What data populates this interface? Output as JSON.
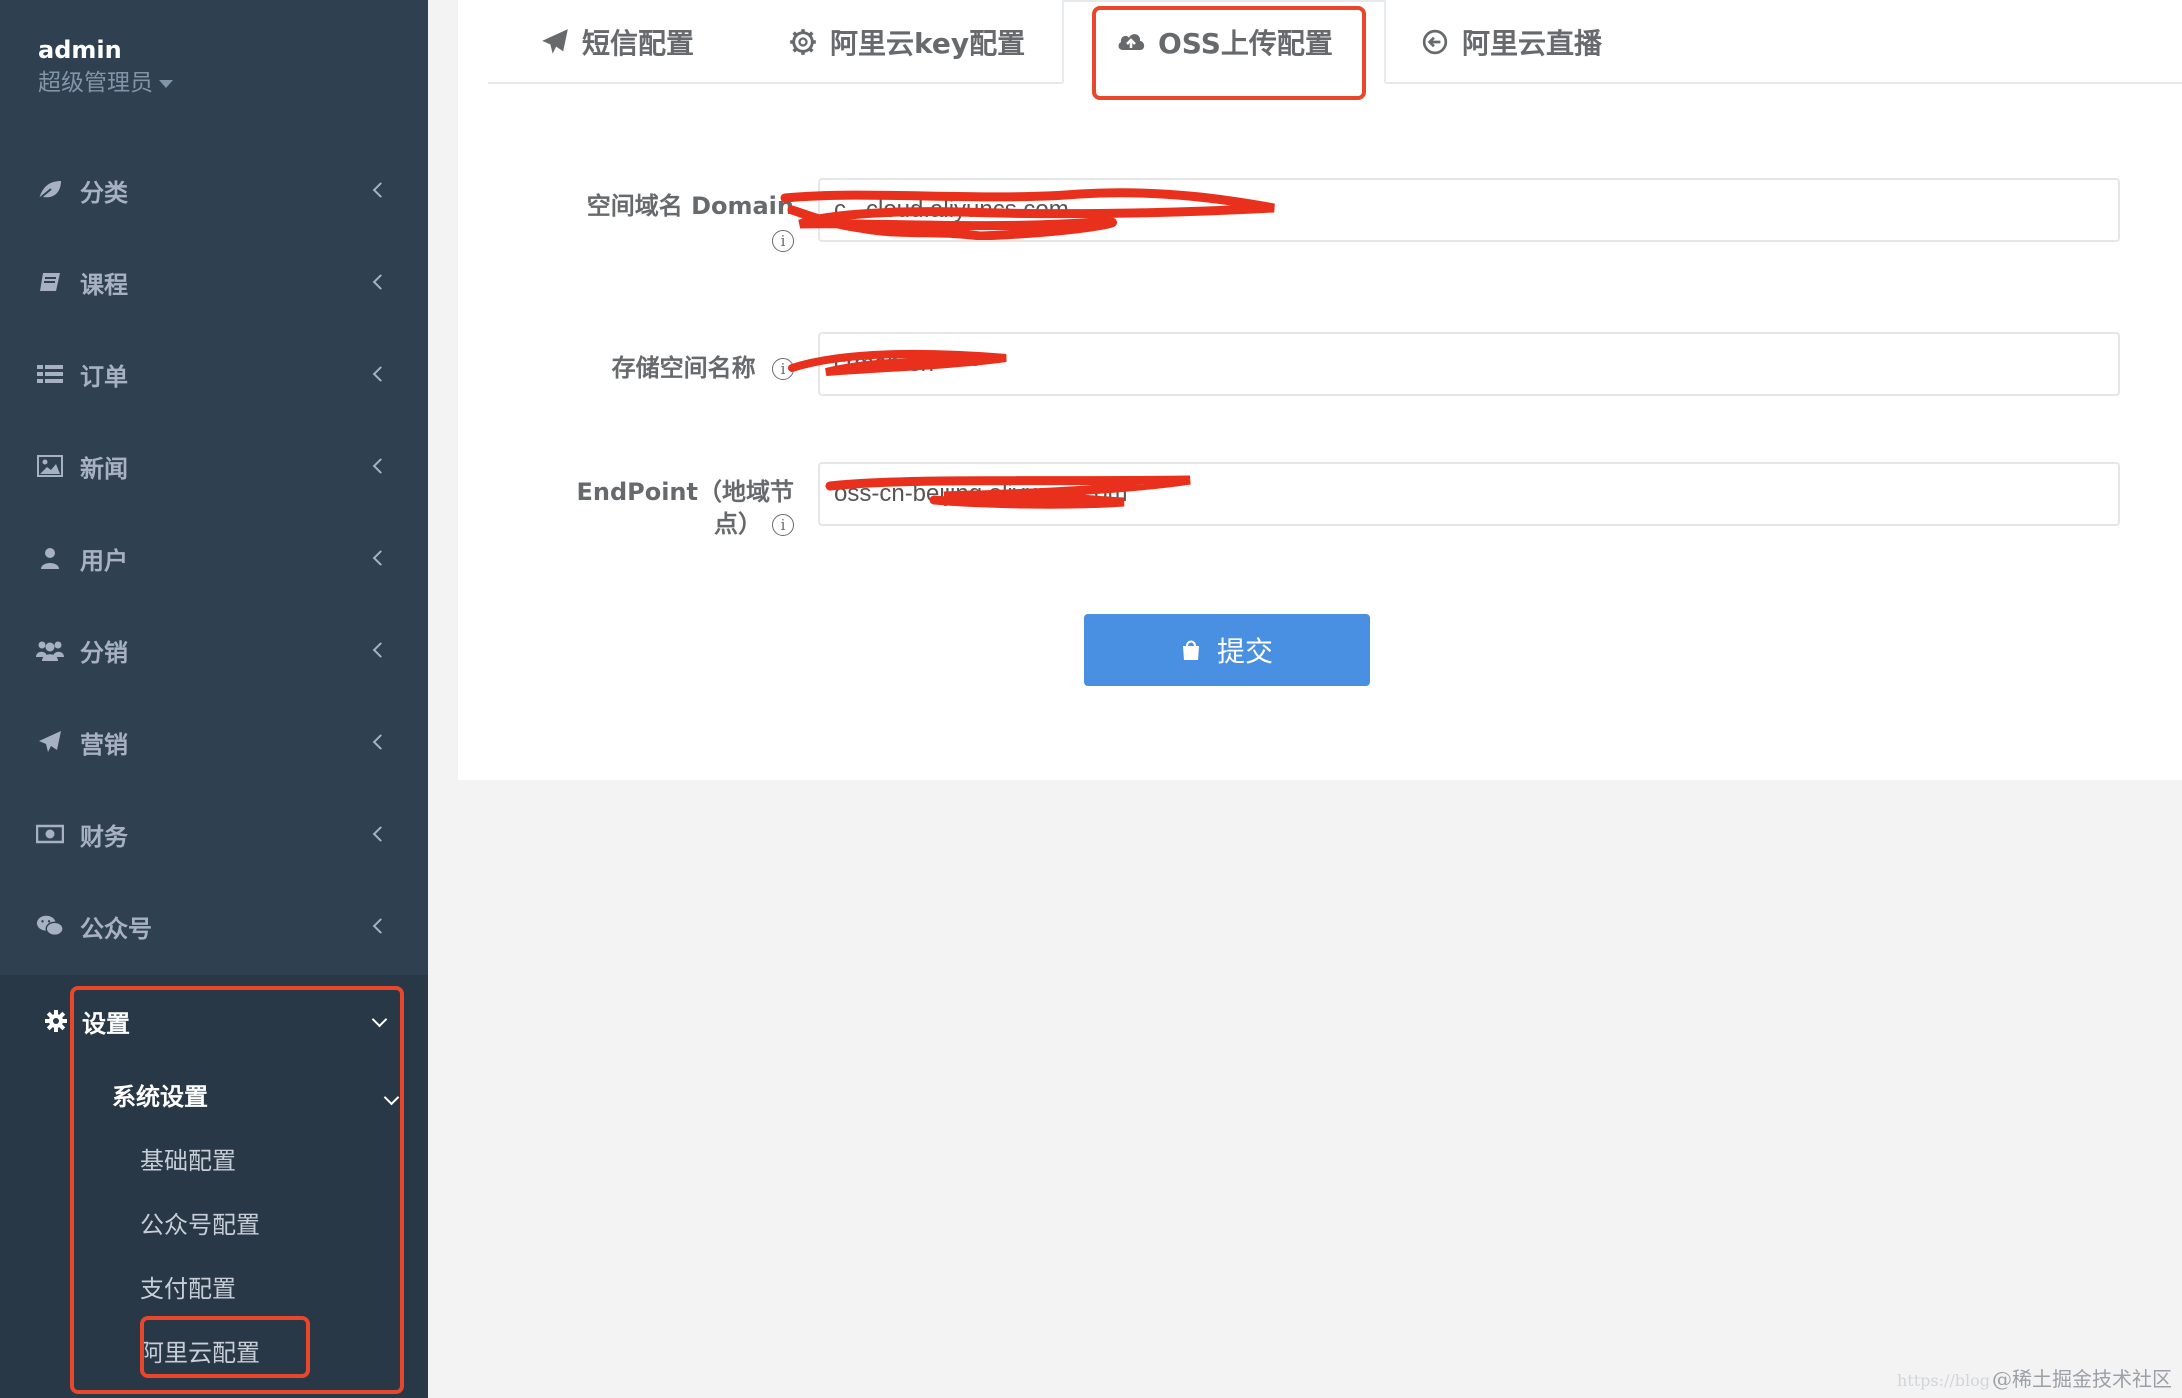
{
  "profile": {
    "name": "admin",
    "role": "超级管理员"
  },
  "sidebar": {
    "items": [
      {
        "label": "分类",
        "icon": "leaf-icon"
      },
      {
        "label": "课程",
        "icon": "book-icon"
      },
      {
        "label": "订单",
        "icon": "list-icon"
      },
      {
        "label": "新闻",
        "icon": "image-icon"
      },
      {
        "label": "用户",
        "icon": "user-icon"
      },
      {
        "label": "分销",
        "icon": "users-icon"
      },
      {
        "label": "营销",
        "icon": "paper-plane-icon"
      },
      {
        "label": "财务",
        "icon": "money-icon"
      },
      {
        "label": "公众号",
        "icon": "wechat-icon"
      }
    ],
    "settings": {
      "label": "设置",
      "submenu": {
        "label": "系统设置",
        "items": [
          "基础配置",
          "公众号配置",
          "支付配置",
          "阿里云配置"
        ]
      }
    }
  },
  "tabs": [
    {
      "label": "短信配置",
      "icon": "paper-plane-icon"
    },
    {
      "label": "阿里云key配置",
      "icon": "gear-icon"
    },
    {
      "label": "OSS上传配置",
      "icon": "cloud-upload-icon",
      "active": true
    },
    {
      "label": "阿里云直播",
      "icon": "arrow-circle-left-icon"
    }
  ],
  "form": {
    "domain": {
      "label": "空间域名 Domain",
      "value": "c...cloud.aliyuncs.com"
    },
    "bucket": {
      "label": "存储空间名称",
      "value": "crmeb-sh"
    },
    "endpoint": {
      "label_line1": "EndPoint（地域节",
      "label_line2": "点）",
      "value": "oss-cn-beijing.aliyuncs.com"
    },
    "info_glyph": "i",
    "submit_label": "提交"
  },
  "watermark": {
    "url": "https://blog",
    "text": "@稀土掘金技术社区"
  },
  "colors": {
    "sidebar": "#2f4050",
    "primary": "#4a90e2",
    "highlight": "#e8472b"
  }
}
